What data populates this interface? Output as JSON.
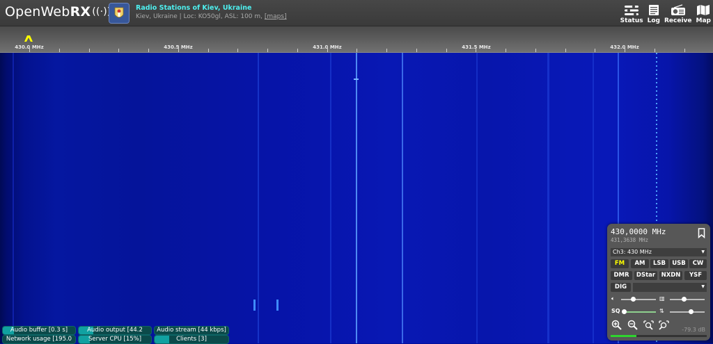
{
  "header": {
    "logo_main": "OpenWeb",
    "logo_rx": "RX",
    "station_title": "Radio Stations of Kiev, Ukraine",
    "station_location": "Kiev, Ukraine | Loc: KO50gl, ASL: 100 m, ",
    "maps_link": "[maps]",
    "nav": [
      {
        "label": "Status",
        "icon": "status-icon"
      },
      {
        "label": "Log",
        "icon": "log-icon"
      },
      {
        "label": "Receive",
        "icon": "receive-icon"
      },
      {
        "label": "Map",
        "icon": "map-icon"
      }
    ]
  },
  "scale": {
    "labels": [
      "430.0 MHz",
      "430.5 MHz",
      "431.0 MHz",
      "431.5 MHz",
      "432.0 MHz"
    ]
  },
  "status_bars": {
    "audio_buffer": {
      "label": "Audio buffer [0.3 s]",
      "level": 0.15
    },
    "audio_output": {
      "label": "Audio output [44.2",
      "level": 0.2
    },
    "audio_stream": {
      "label": "Audio stream [44 kbps]",
      "level": 0.0
    },
    "network_usage": {
      "label": "Network usage [195.0",
      "level": 0.0
    },
    "server_cpu": {
      "label": "Server CPU [15%]",
      "level": 0.15
    },
    "clients": {
      "label": "Clients [3]",
      "level": 0.2
    }
  },
  "receiver": {
    "frequency": "430,0000 MHz",
    "sub_frequency": "431,3638 MHz",
    "channel": "Ch3: 430 MHz",
    "modes_row1": [
      "FM",
      "AM",
      "LSB",
      "USB",
      "CW"
    ],
    "modes_row2": [
      "DMR",
      "DStar",
      "NXDN",
      "YSF"
    ],
    "dig_label": "DIG",
    "active_mode": "FM",
    "volume_level": 0.35,
    "nr_level": 0.4,
    "squelch_level": 0.05,
    "eq_level": 0.6,
    "db_value": "-79.3 dB",
    "smeter_level": 0.27
  }
}
